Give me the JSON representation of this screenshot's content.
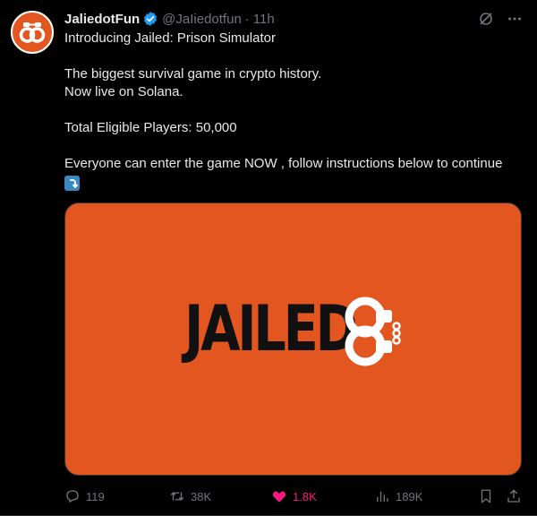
{
  "author": {
    "display_name": "JaliedotFun",
    "handle": "@JaIiedotfun",
    "separator": "·",
    "time": "11h",
    "verified": true
  },
  "tweet": {
    "lines": [
      "Introducing Jailed: Prison Simulator",
      "The biggest survival game in crypto history.",
      "Now live on Solana.",
      "Total Eligible Players: 50,000",
      "Everyone can enter the game NOW , follow instructions below to continue"
    ],
    "emoji": "right-arrow-curving-down"
  },
  "media": {
    "logo_text": "JAILED",
    "background": "#e3561f"
  },
  "actions": {
    "replies": "119",
    "reposts": "38K",
    "likes": "1.8K",
    "views": "189K"
  },
  "colors": {
    "accent_like": "#f91880",
    "muted": "#71767b",
    "verified": "#1d9bf0",
    "brand_orange": "#e2561f"
  }
}
